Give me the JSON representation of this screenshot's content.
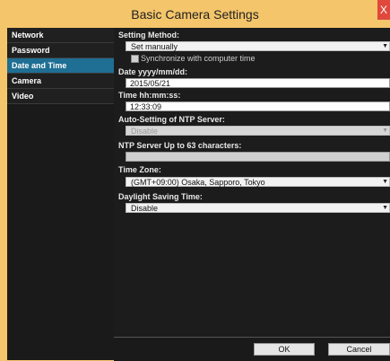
{
  "window": {
    "title": "Basic Camera Settings",
    "close_label": "X"
  },
  "sidebar": {
    "items": [
      {
        "label": "Network"
      },
      {
        "label": "Password"
      },
      {
        "label": "Date and Time",
        "active": true
      },
      {
        "label": "Camera"
      },
      {
        "label": "Video"
      }
    ]
  },
  "form": {
    "setting_method": {
      "label": "Setting Method:",
      "value": "Set manually"
    },
    "sync": {
      "label": "Synchronize with computer time",
      "checked": false
    },
    "date": {
      "label": "Date  yyyy/mm/dd:",
      "value": "2015/05/21"
    },
    "time": {
      "label": "Time  hh:mm:ss:",
      "value": "12:33:09"
    },
    "ntp_auto": {
      "label": "Auto-Setting of NTP Server:",
      "value": "Disable"
    },
    "ntp_server": {
      "label": "NTP Server  Up to 63 characters:",
      "value": ""
    },
    "timezone": {
      "label": "Time Zone:",
      "value": "(GMT+09:00) Osaka, Sapporo, Tokyo"
    },
    "dst": {
      "label": "Daylight Saving Time:",
      "value": "Disable"
    }
  },
  "buttons": {
    "ok": "OK",
    "cancel": "Cancel"
  },
  "colors": {
    "title_bar": "#f4c56a",
    "active_sidebar": "#1f6e93",
    "panel_bg": "#1c1c1c"
  }
}
